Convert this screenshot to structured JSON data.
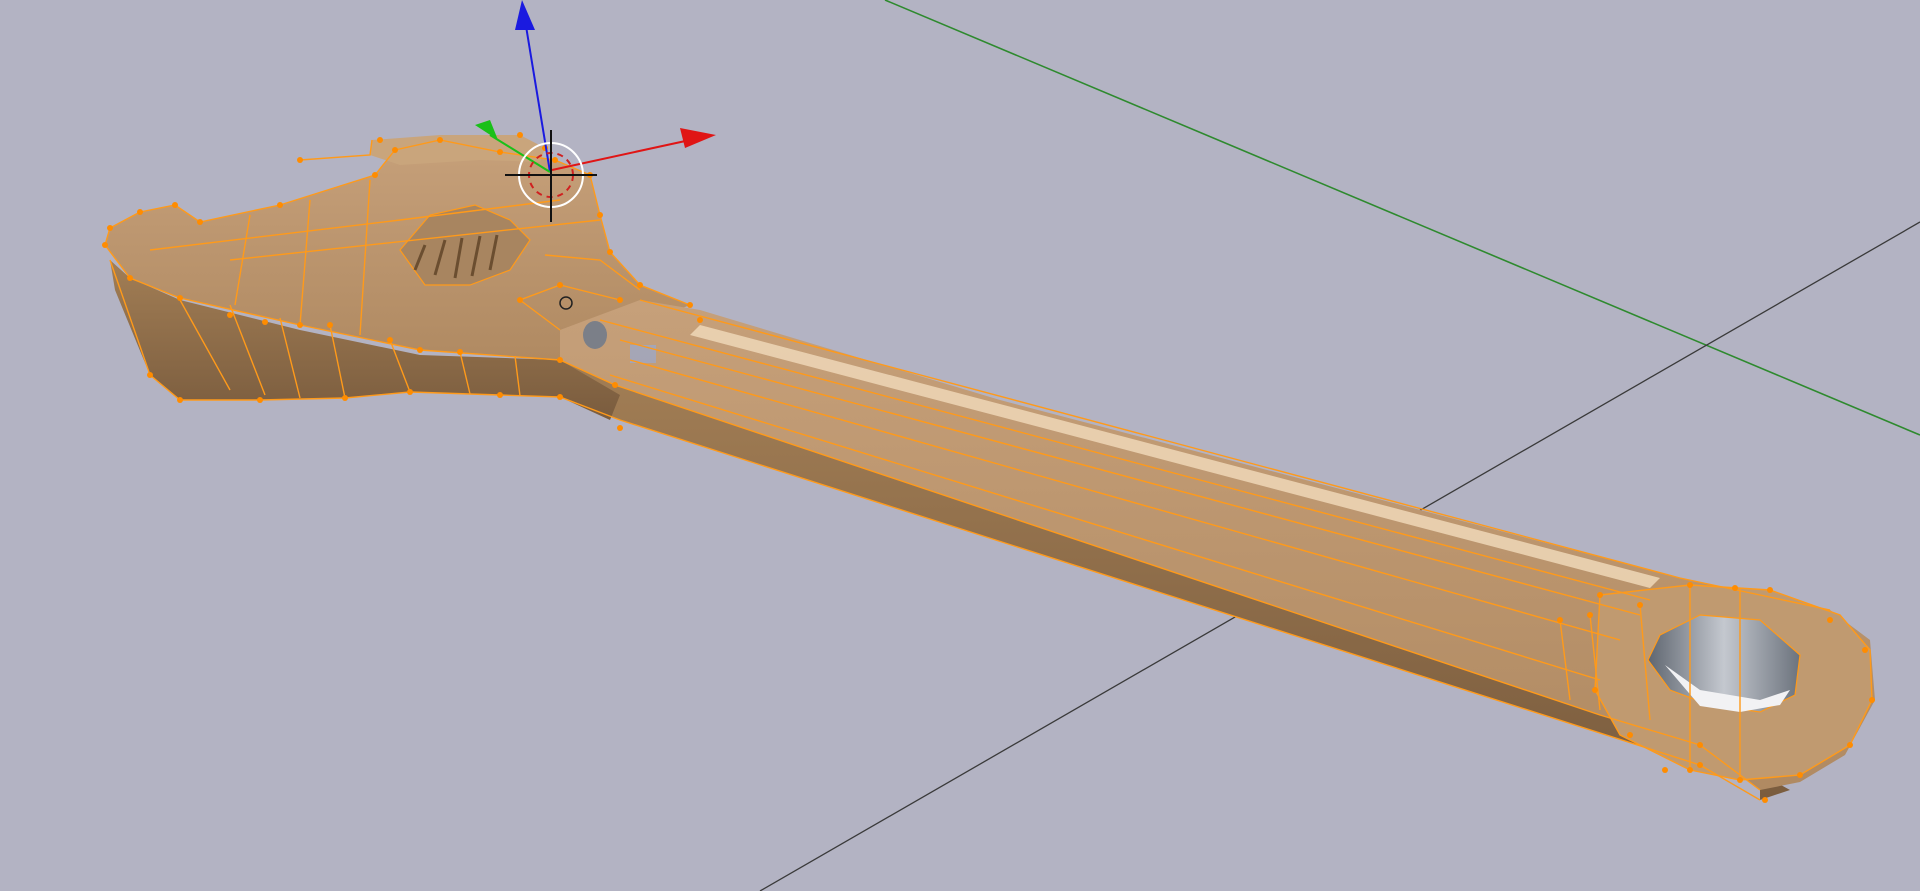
{
  "viewport": {
    "name": "3d-viewport",
    "background": "#b3b3c3"
  },
  "object": {
    "name": "wrench",
    "mode": "edit",
    "base_color": "#b08a5e",
    "shadow_color": "#7d5f40",
    "highlight_color": "#e6c9a3",
    "wire_color": "#ff9a1a",
    "vertex_color": "#ff8c00"
  },
  "axes": {
    "x_line_color": "#3a3a3a",
    "y_line_color": "#2e8a2e"
  },
  "gizmo": {
    "x_color": "#e01515",
    "y_color": "#19c019",
    "z_color": "#1a1ae0"
  },
  "cursor": {
    "name": "3d-cursor",
    "ring_outer": "#ffffff",
    "ring_inner": "#d02020"
  }
}
